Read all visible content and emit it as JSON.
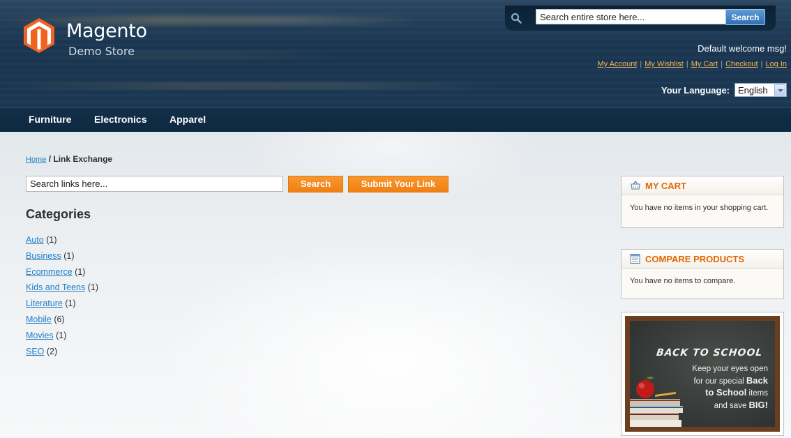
{
  "header": {
    "logo_name": "Magento",
    "logo_sub": "Demo Store",
    "search_placeholder": "Search entire store here...",
    "search_button": "Search",
    "welcome": "Default welcome msg!",
    "links": [
      "My Account",
      "My Wishlist",
      "My Cart",
      "Checkout",
      "Log In"
    ],
    "link_separator": "|",
    "language_label": "Your Language:",
    "language_value": "English"
  },
  "nav": {
    "items": [
      "Furniture",
      "Electronics",
      "Apparel"
    ]
  },
  "breadcrumbs": {
    "home": "Home",
    "separator": "/",
    "current": "Link Exchange"
  },
  "links_search": {
    "placeholder": "Search links here...",
    "search_button": "Search",
    "submit_button": "Submit Your Link"
  },
  "categories": {
    "title": "Categories",
    "items": [
      {
        "name": "Auto",
        "count": "(1)"
      },
      {
        "name": "Business",
        "count": "(1)"
      },
      {
        "name": "Ecommerce",
        "count": "(1)"
      },
      {
        "name": "Kids and Teens",
        "count": "(1)"
      },
      {
        "name": "Literature",
        "count": "(1)"
      },
      {
        "name": "Mobile",
        "count": "(6)"
      },
      {
        "name": "Movies",
        "count": "(1)"
      },
      {
        "name": "SEO",
        "count": "(2)"
      }
    ]
  },
  "sidebar": {
    "cart": {
      "title": "MY CART",
      "icon": "cart-icon",
      "text": "You have no items in your shopping cart."
    },
    "compare": {
      "title": "COMPARE PRODUCTS",
      "icon": "compare-icon",
      "text": "You have no items to compare."
    },
    "promo": {
      "title": "BACK TO SCHOOL",
      "line1": "Keep your eyes open",
      "line2_pre": "for our special ",
      "line2_bold": "Back",
      "line3_bold": "to School",
      "line3_post": " items",
      "line4_pre": "and save ",
      "line4_bold": "BIG!"
    }
  },
  "colors": {
    "header_bg": "#1a3550",
    "nav_bg": "#0e2940",
    "accent_orange": "#f08514",
    "link_blue": "#1e7ec8",
    "header_link": "#e9b35c",
    "block_title": "#e26703"
  }
}
